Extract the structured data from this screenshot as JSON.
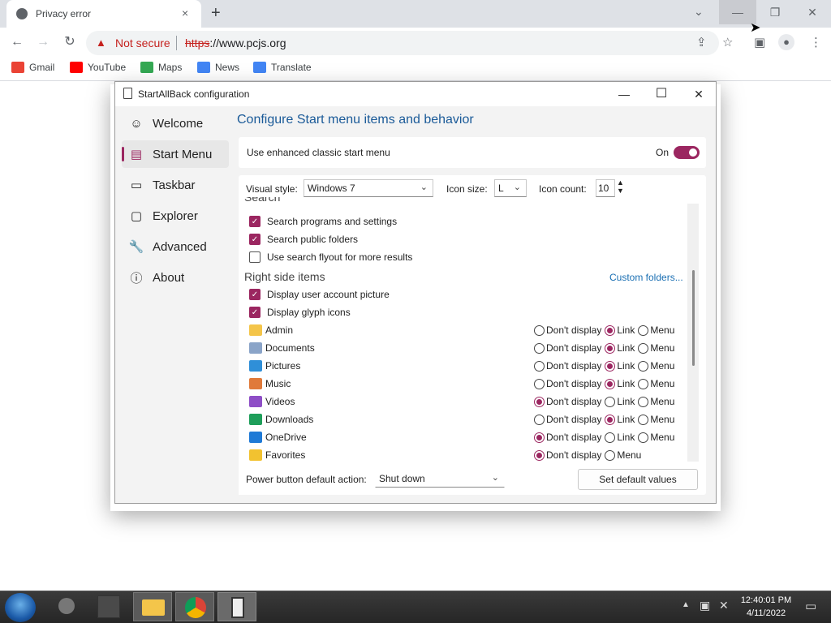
{
  "browser": {
    "tab_title": "Privacy error",
    "close_tab": "×",
    "new_tab": "+",
    "tab_search": "⌄",
    "win_min": "—",
    "win_max": "❐",
    "win_close": "✕",
    "back": "←",
    "forward": "→",
    "reload": "↻",
    "security_label": "Not secure",
    "url_scheme": "https",
    "url_rest": "://www.pcjs.org",
    "bookmarks": [
      {
        "label": "Gmail",
        "color": "#ea4335"
      },
      {
        "label": "YouTube",
        "color": "#ff0000"
      },
      {
        "label": "Maps",
        "color": "#34a853"
      },
      {
        "label": "News",
        "color": "#4285f4"
      },
      {
        "label": "Translate",
        "color": "#4285f4"
      }
    ]
  },
  "dialog": {
    "title": "StartAllBack configuration",
    "min": "—",
    "max": "☐",
    "close": "✕",
    "sidebar": [
      {
        "label": "Welcome",
        "icon": "smile-icon",
        "glyph": "☺"
      },
      {
        "label": "Start Menu",
        "icon": "start-menu-icon",
        "glyph": "▤"
      },
      {
        "label": "Taskbar",
        "icon": "taskbar-icon",
        "glyph": "▭"
      },
      {
        "label": "Explorer",
        "icon": "explorer-icon",
        "glyph": "▢"
      },
      {
        "label": "Advanced",
        "icon": "wrench-icon",
        "glyph": "🔧"
      },
      {
        "label": "About",
        "icon": "info-icon",
        "glyph": "ⓘ"
      }
    ],
    "heading": "Configure Start menu items and behavior",
    "enhanced_label": "Use enhanced classic start menu",
    "toggle_state": "On",
    "visual_style_label": "Visual style:",
    "visual_style_value": "Windows 7",
    "icon_size_label": "Icon size:",
    "icon_size_value": "L",
    "icon_count_label": "Icon count:",
    "icon_count_value": "10",
    "search_section": "Search",
    "search_items": [
      {
        "label": "Search programs and settings",
        "checked": true
      },
      {
        "label": "Search public folders",
        "checked": true
      },
      {
        "label": "Use search flyout for more results",
        "checked": false
      }
    ],
    "right_section": "Right side items",
    "custom_folders": "Custom folders...",
    "right_checks": [
      {
        "label": "Display user account picture",
        "checked": true
      },
      {
        "label": "Display glyph icons",
        "checked": true
      }
    ],
    "radio_labels": {
      "dont": "Don't display",
      "link": "Link",
      "menu": "Menu"
    },
    "folders": [
      {
        "label": "Admin",
        "selected": "link",
        "color": "#f4c54a"
      },
      {
        "label": "Documents",
        "selected": "link",
        "color": "#8aa4c8"
      },
      {
        "label": "Pictures",
        "selected": "link",
        "color": "#2f8fd8"
      },
      {
        "label": "Music",
        "selected": "link",
        "color": "#e07a3a"
      },
      {
        "label": "Videos",
        "selected": "dont",
        "color": "#8e4ec6"
      },
      {
        "label": "Downloads",
        "selected": "link",
        "color": "#1e9e5a"
      },
      {
        "label": "OneDrive",
        "selected": "dont",
        "color": "#1f7ad6"
      },
      {
        "label": "Favorites",
        "selected": "dont",
        "color": "#f2c230"
      }
    ],
    "power_label": "Power button default action:",
    "power_value": "Shut down",
    "set_default": "Set default values"
  },
  "taskbar": {
    "time": "12:40:01 PM",
    "date": "4/11/2022"
  }
}
